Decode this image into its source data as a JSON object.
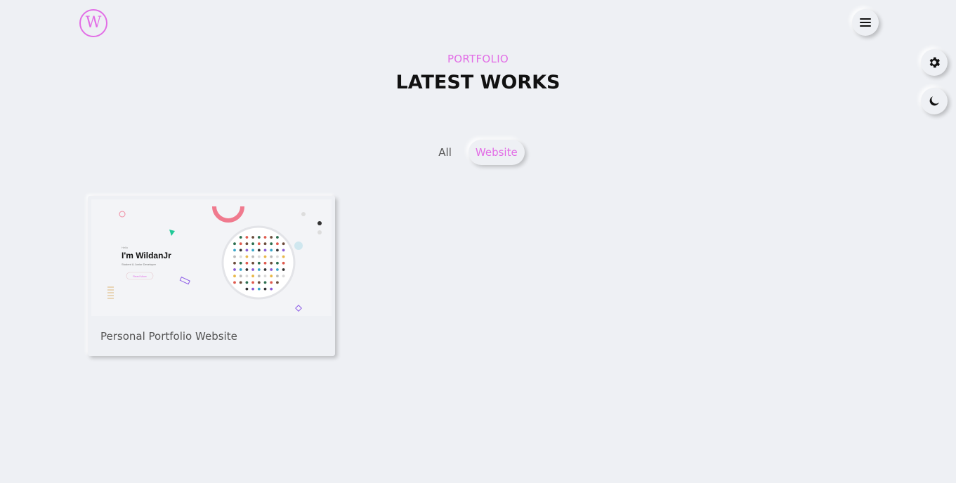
{
  "logo": {
    "letter": "W"
  },
  "section": {
    "subtitle": "PORTFOLIO",
    "title": "LATEST WORKS"
  },
  "filters": [
    {
      "label": "All",
      "active": false
    },
    {
      "label": "Website",
      "active": true
    }
  ],
  "projects": [
    {
      "title": "Personal Portfolio Website",
      "thumbnail": {
        "heading": "I'm WildanJr",
        "caption": "Student & Junior Developer",
        "button": "Read More",
        "greeting": "Hello"
      }
    }
  ],
  "icons": {
    "menu": "hamburger-icon",
    "settings": "gear-icon",
    "theme": "moon-icon"
  },
  "colors": {
    "accent": "#e26ee6",
    "background": "#eef0f4",
    "text": "#111111"
  }
}
